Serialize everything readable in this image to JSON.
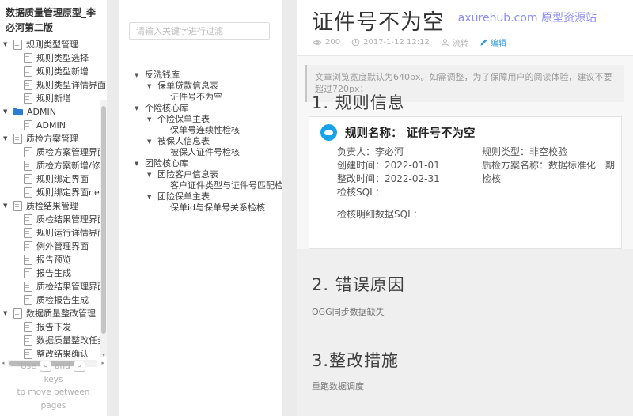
{
  "sidebar": {
    "title": "数据质量管理原型_李必河第二版",
    "tree": [
      {
        "label": "规则类型管理",
        "level": 0,
        "icon": "page",
        "arrow": true
      },
      {
        "label": "规则类型选择",
        "level": 1,
        "icon": "page",
        "arrow": false
      },
      {
        "label": "规则类型新增",
        "level": 1,
        "icon": "page",
        "arrow": false
      },
      {
        "label": "规则类型详情界面",
        "level": 1,
        "icon": "page",
        "arrow": false
      },
      {
        "label": "规则新增",
        "level": 1,
        "icon": "page",
        "arrow": false
      },
      {
        "label": "ADMIN",
        "level": 0,
        "icon": "folder",
        "arrow": true
      },
      {
        "label": "ADMIN",
        "level": 1,
        "icon": "page",
        "arrow": false
      },
      {
        "label": "质检方案管理",
        "level": 0,
        "icon": "page",
        "arrow": true
      },
      {
        "label": "质检方案管理界面",
        "level": 1,
        "icon": "page",
        "arrow": false
      },
      {
        "label": "质检方案新增/修改弹窗",
        "level": 1,
        "icon": "page",
        "arrow": false
      },
      {
        "label": "规则绑定界面",
        "level": 1,
        "icon": "page",
        "arrow": false
      },
      {
        "label": "规则绑定界面new",
        "level": 1,
        "icon": "page",
        "arrow": false
      },
      {
        "label": "质检结果管理",
        "level": 0,
        "icon": "page",
        "arrow": true
      },
      {
        "label": "质检结果管理界面",
        "level": 1,
        "icon": "page",
        "arrow": false
      },
      {
        "label": "规则运行详情界面",
        "level": 1,
        "icon": "page",
        "arrow": false
      },
      {
        "label": "例外管理界面",
        "level": 1,
        "icon": "page",
        "arrow": false
      },
      {
        "label": "报告预览",
        "level": 1,
        "icon": "page",
        "arrow": false
      },
      {
        "label": "报告生成",
        "level": 1,
        "icon": "page",
        "arrow": false
      },
      {
        "label": "质检结果管理界面new",
        "level": 1,
        "icon": "page",
        "arrow": false
      },
      {
        "label": "质检报告生成",
        "level": 1,
        "icon": "page",
        "arrow": false
      },
      {
        "label": "数据质量整改管理",
        "level": 0,
        "icon": "page",
        "arrow": true
      },
      {
        "label": "报告下发",
        "level": 1,
        "icon": "page",
        "arrow": false
      },
      {
        "label": "数据质量整改任务创建",
        "level": 1,
        "icon": "page",
        "arrow": false
      },
      {
        "label": "整改结果确认",
        "level": 1,
        "icon": "page",
        "arrow": false
      }
    ],
    "footer": {
      "use": "Use",
      "key_prev": "<",
      "and": "and",
      "key_next": ">",
      "line2": "keys",
      "line3": "to move between",
      "line4": "pages"
    }
  },
  "filter_panel": {
    "search_placeholder": "请输入关键字进行过滤",
    "tree": [
      {
        "label": "反洗钱库",
        "level": 0,
        "arrow": true
      },
      {
        "label": "保单贷款信息表",
        "level": 1,
        "arrow": true
      },
      {
        "label": "证件号不为空",
        "level": 2,
        "arrow": false
      },
      {
        "label": "个险核心库",
        "level": 0,
        "arrow": true
      },
      {
        "label": "个险保单主表",
        "level": 1,
        "arrow": true
      },
      {
        "label": "保单号连续性检核",
        "level": 2,
        "arrow": false
      },
      {
        "label": "被保人信息表",
        "level": 1,
        "arrow": true
      },
      {
        "label": "被保人证件号检核",
        "level": 2,
        "arrow": false
      },
      {
        "label": "团险核心库",
        "level": 0,
        "arrow": true
      },
      {
        "label": "团险客户信息表",
        "level": 1,
        "arrow": true
      },
      {
        "label": "客户证件类型与证件号匹配检核",
        "level": 2,
        "arrow": false
      },
      {
        "label": "团险保单主表",
        "level": 1,
        "arrow": true
      },
      {
        "label": "保单id与保单号关系检核",
        "level": 2,
        "arrow": false
      }
    ]
  },
  "main": {
    "title": "证件号不为空",
    "site_link": "axurehub.com 原型资源站",
    "meta": {
      "views": "200",
      "datetime": "2017-1-12 12:12",
      "author": "流转",
      "edit_label": "编辑"
    },
    "notice": "文章浏览宽度默认为640px。如需调整，为了保障用户的阅读体验，建议不要超过720px；",
    "section1": {
      "heading": "1. 规则信息",
      "card": {
        "rule_name_label": "规则名称：",
        "rule_name_value": "证件号不为空",
        "owner": "负责人：李必河",
        "created": "创建时间：2022-01-01",
        "rectify_time": "整改时间：2022-02-31",
        "check_sql": "检核SQL：",
        "check_detail_sql": "检核明细数据SQL：",
        "rule_type": "规则类型：非空校验",
        "plan_name": "质检方案名称：数据标准化一期检核"
      }
    },
    "section2": {
      "heading": "2. 错误原因",
      "body": "OGG同步数据缺失"
    },
    "section3": {
      "heading": "3.整改措施",
      "body": "重跑数据调度"
    }
  },
  "colors": {
    "accent_blue": "#18a2e9",
    "edit_link_blue": "#2f9bd8",
    "site_link_purple": "#8d8df2",
    "folder_blue": "#2b7cd3"
  }
}
